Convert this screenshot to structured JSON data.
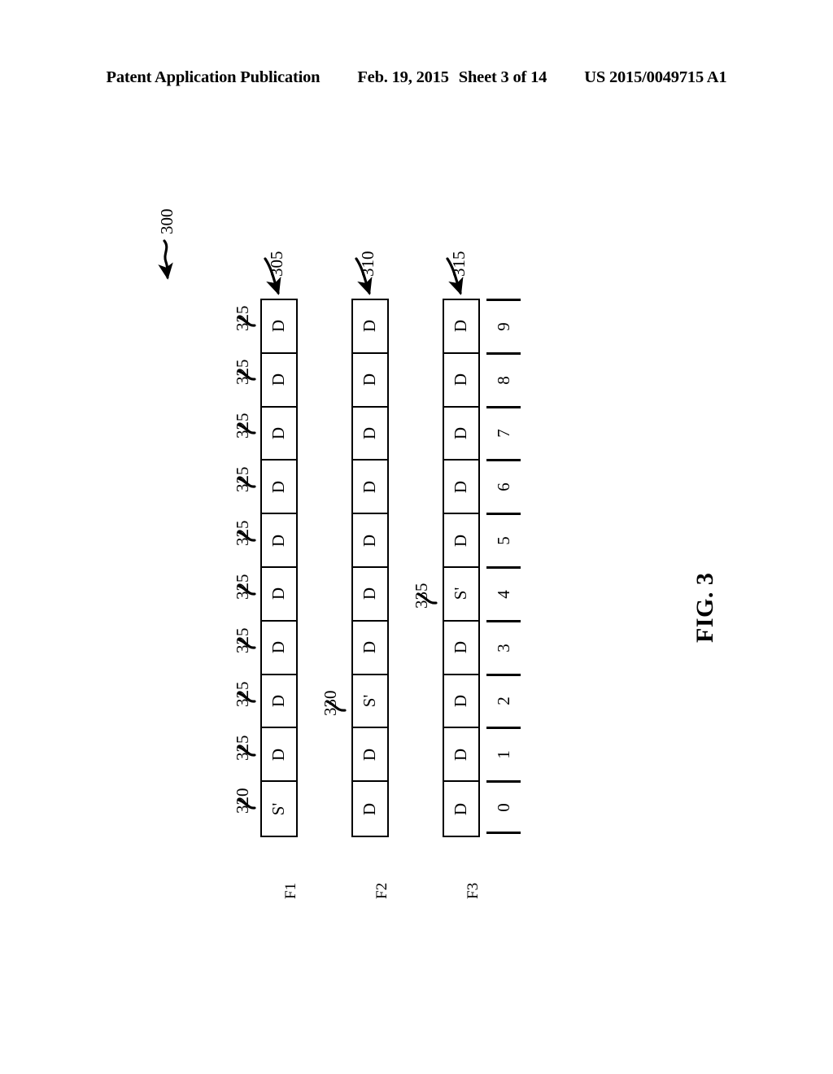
{
  "header": {
    "publication": "Patent Application Publication",
    "date": "Feb. 19, 2015",
    "sheet": "Sheet 3 of 14",
    "patent_number": "US 2015/0049715 A1"
  },
  "figure": {
    "caption": "FIG. 3",
    "figure_ref": "300"
  },
  "chart_data": {
    "type": "table",
    "title": "FIG. 3",
    "description": "Three parallel frame streams F1, F2 and F3, each a row of ten time-slot cells indexed 0 through 9. Each cell holds either a data frame 'D' or a synchronization frame 'S'' (S-prime). The S' frame is staggered across the streams: slot 0 in F1, slot 2 in F2, slot 4 in F3.",
    "categories": [
      "0",
      "1",
      "2",
      "3",
      "4",
      "5",
      "6",
      "7",
      "8",
      "9"
    ],
    "xlabel": "",
    "ylabel": "",
    "series": [
      {
        "name": "F1",
        "ref": "305",
        "values": [
          "S'",
          "D",
          "D",
          "D",
          "D",
          "D",
          "D",
          "D",
          "D",
          "D"
        ]
      },
      {
        "name": "F2",
        "ref": "310",
        "values": [
          "D",
          "D",
          "S'",
          "D",
          "D",
          "D",
          "D",
          "D",
          "D",
          "D"
        ]
      },
      {
        "name": "F3",
        "ref": "315",
        "values": [
          "D",
          "D",
          "D",
          "D",
          "S'",
          "D",
          "D",
          "D",
          "D",
          "D"
        ]
      }
    ]
  },
  "rows": [
    {
      "name": "F1",
      "ref": "305",
      "cells": [
        {
          "label": "S'",
          "index": "0"
        },
        {
          "label": "D",
          "index": "1"
        },
        {
          "label": "D",
          "index": "2"
        },
        {
          "label": "D",
          "index": "3"
        },
        {
          "label": "D",
          "index": "4"
        },
        {
          "label": "D",
          "index": "5"
        },
        {
          "label": "D",
          "index": "6"
        },
        {
          "label": "D",
          "index": "7"
        },
        {
          "label": "D",
          "index": "8"
        },
        {
          "label": "D",
          "index": "9"
        }
      ]
    },
    {
      "name": "F2",
      "ref": "310",
      "cells": [
        {
          "label": "D",
          "index": "0"
        },
        {
          "label": "D",
          "index": "1"
        },
        {
          "label": "S'",
          "index": "2"
        },
        {
          "label": "D",
          "index": "3"
        },
        {
          "label": "D",
          "index": "4"
        },
        {
          "label": "D",
          "index": "5"
        },
        {
          "label": "D",
          "index": "6"
        },
        {
          "label": "D",
          "index": "7"
        },
        {
          "label": "D",
          "index": "8"
        },
        {
          "label": "D",
          "index": "9"
        }
      ]
    },
    {
      "name": "F3",
      "ref": "315",
      "cells": [
        {
          "label": "D",
          "index": "0"
        },
        {
          "label": "D",
          "index": "1"
        },
        {
          "label": "D",
          "index": "2"
        },
        {
          "label": "D",
          "index": "3"
        },
        {
          "label": "S'",
          "index": "4"
        },
        {
          "label": "D",
          "index": "5"
        },
        {
          "label": "D",
          "index": "6"
        },
        {
          "label": "D",
          "index": "7"
        },
        {
          "label": "D",
          "index": "8"
        },
        {
          "label": "D",
          "index": "9"
        }
      ]
    }
  ],
  "axis": {
    "ticks": [
      "0",
      "1",
      "2",
      "3",
      "4",
      "5",
      "6",
      "7",
      "8",
      "9"
    ]
  },
  "callouts": {
    "sync_first": "320",
    "data_cell": "325",
    "sync_f2": "330",
    "sync_f3": "335"
  },
  "data_cell_refs": [
    "325",
    "325",
    "325",
    "325",
    "325",
    "325",
    "325",
    "325",
    "325"
  ]
}
